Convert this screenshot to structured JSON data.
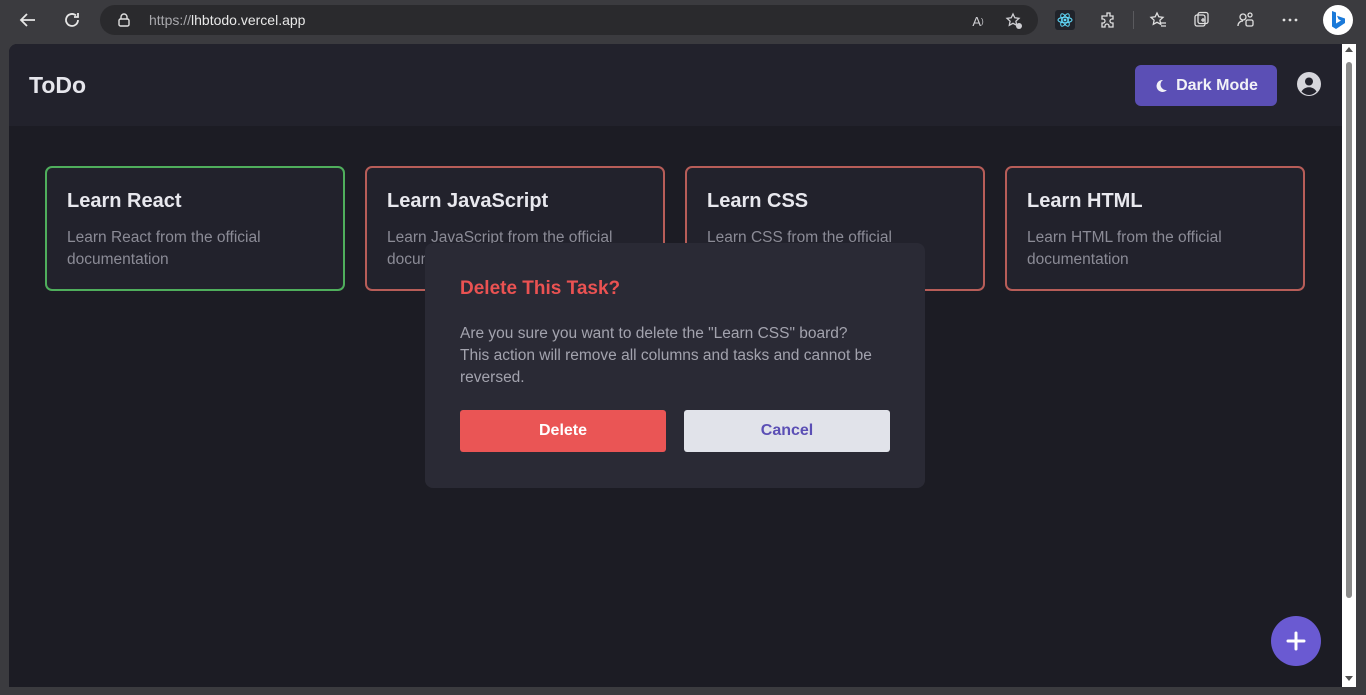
{
  "browser": {
    "url_prefix": "https://",
    "url_host": "lhbtodo.vercel.app",
    "icons": [
      "back-arrow-icon",
      "refresh-icon",
      "lock-icon",
      "read-aloud-icon",
      "add-favorite-icon",
      "react-devtools-icon",
      "extensions-icon",
      "favorites-icon",
      "collections-icon",
      "profile-sync-icon",
      "more-menu-icon",
      "bing-copilot-icon"
    ]
  },
  "app": {
    "title": "ToDo",
    "dark_mode_label": "Dark Mode",
    "accent": "#5b4fb5"
  },
  "boards": [
    {
      "title": "Learn React",
      "description": "Learn React from the official documentation",
      "border_color": "#4fae5c"
    },
    {
      "title": "Learn JavaScript",
      "description": "Learn JavaScript from the official documentation",
      "border_color": "#b75d58"
    },
    {
      "title": "Learn CSS",
      "description": "Learn CSS from the official documentation",
      "border_color": "#b75d58"
    },
    {
      "title": "Learn HTML",
      "description": "Learn HTML from the official documentation",
      "border_color": "#b75d58"
    }
  ],
  "modal": {
    "title": "Delete This Task?",
    "message": "Are you sure you want to delete the \"Learn CSS\" board? This action will remove all columns and tasks and cannot be reversed.",
    "delete_label": "Delete",
    "cancel_label": "Cancel",
    "danger_color": "#ea5252"
  }
}
